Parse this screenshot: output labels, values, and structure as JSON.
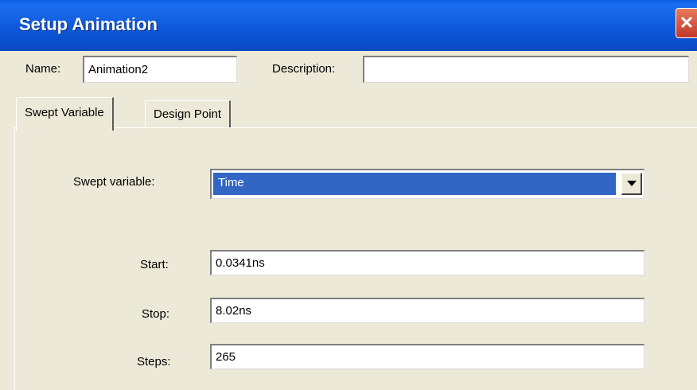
{
  "window": {
    "title": "Setup Animation",
    "close_glyph": "✕"
  },
  "header": {
    "name_label": "Name:",
    "name_value": "Animation2",
    "description_label": "Description:",
    "description_value": ""
  },
  "tabs": [
    {
      "label": "Swept Variable",
      "active": true
    },
    {
      "label": "Design Point",
      "active": false
    }
  ],
  "swept": {
    "variable_label": "Swept variable:",
    "variable_value": "Time",
    "start_label": "Start:",
    "start_value": "0.0341ns",
    "stop_label": "Stop:",
    "stop_value": "8.02ns",
    "steps_label": "Steps:",
    "steps_value": "265"
  },
  "icons": {
    "close": "close-icon",
    "dropdown": "chevron-down-icon"
  },
  "colors": {
    "titlebar": "#0c57d8",
    "selection": "#3166c5",
    "dialog_bg": "#ece9d8",
    "close": "#c0392b"
  }
}
